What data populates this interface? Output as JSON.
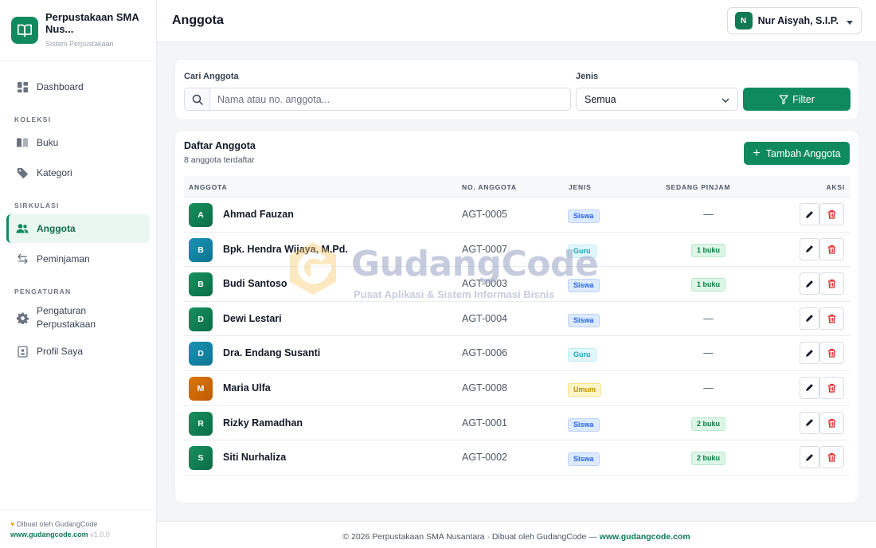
{
  "brand": {
    "title": "Perpustakaan SMA Nus...",
    "subtitle": "Sistem Perpustakaan"
  },
  "nav": {
    "dashboard": "Dashboard",
    "sec_koleksi": "KOLEKSI",
    "buku": "Buku",
    "kategori": "Kategori",
    "sec_sirkulasi": "SIRKULASI",
    "anggota": "Anggota",
    "peminjaman": "Peminjaman",
    "sec_pengaturan": "PENGATURAN",
    "pengaturan_1": "Pengaturan",
    "pengaturan_2": "Perpustakaan",
    "profil": "Profil Saya"
  },
  "sidebar_footer": {
    "made_by": "Dibuat oleh GudangCode",
    "url": "www.gudangcode.com",
    "version": "v1.0.0"
  },
  "header": {
    "title": "Anggota",
    "user_initial": "N",
    "user_name": "Nur Aisyah, S.I.P."
  },
  "filter": {
    "search_label": "Cari Anggota",
    "search_placeholder": "Nama atau no. anggota...",
    "type_label": "Jenis",
    "type_value": "Semua",
    "button": "Filter"
  },
  "table": {
    "title": "Daftar Anggota",
    "subtitle": "8 anggota terdaftar",
    "add_button": "Tambah Anggota",
    "headers": [
      "ANGGOTA",
      "NO. ANGGOTA",
      "JENIS",
      "SEDANG PINJAM",
      "AKSI"
    ],
    "rows": [
      {
        "initial": "A",
        "name": "Ahmad Fauzan",
        "no": "AGT-0005",
        "type": "Siswa",
        "loan": "—"
      },
      {
        "initial": "B",
        "name": "Bpk. Hendra Wijaya, M.Pd.",
        "no": "AGT-0007",
        "type": "Guru",
        "loan": "1 buku"
      },
      {
        "initial": "B",
        "name": "Budi Santoso",
        "no": "AGT-0003",
        "type": "Siswa",
        "loan": "1 buku"
      },
      {
        "initial": "D",
        "name": "Dewi Lestari",
        "no": "AGT-0004",
        "type": "Siswa",
        "loan": "—"
      },
      {
        "initial": "D",
        "name": "Dra. Endang Susanti",
        "no": "AGT-0006",
        "type": "Guru",
        "loan": "—"
      },
      {
        "initial": "M",
        "name": "Maria Ulfa",
        "no": "AGT-0008",
        "type": "Umum",
        "loan": "—"
      },
      {
        "initial": "R",
        "name": "Rizky Ramadhan",
        "no": "AGT-0001",
        "type": "Siswa",
        "loan": "2 buku"
      },
      {
        "initial": "S",
        "name": "Siti Nurhaliza",
        "no": "AGT-0002",
        "type": "Siswa",
        "loan": "2 buku"
      }
    ]
  },
  "watermark": {
    "title": "GudangCode",
    "subtitle": "Pusat Aplikasi & Sistem Informasi Bisnis"
  },
  "footer": {
    "text": "© 2026 Perpustakaan SMA Nusantara · Dibuat oleh GudangCode — ",
    "url": "www.gudangcode.com"
  },
  "colors": {
    "primary": "#0f8a5f",
    "siswa": "#2563eb",
    "guru": "#16a6c4",
    "umum": "#c58b07",
    "delete": "#dc2626"
  }
}
